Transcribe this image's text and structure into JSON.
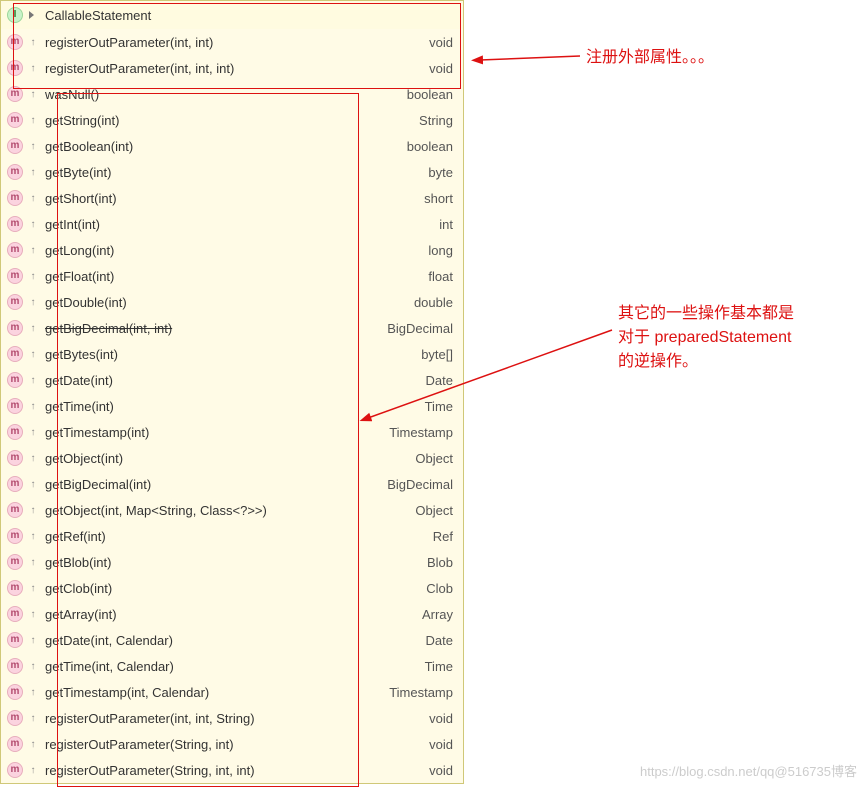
{
  "header": {
    "name": "CallableStatement"
  },
  "annotations": {
    "top": "注册外部属性。。。",
    "mid1": "其它的一些操作基本都是",
    "mid2": "对于   preparedStatement",
    "mid3": "的逆操作。"
  },
  "watermark": "https://blog.csdn.net/qq@516735博客",
  "methods": [
    {
      "name": "registerOutParameter(int, int)",
      "ret": "void",
      "mod": "↑"
    },
    {
      "name": "registerOutParameter(int, int, int)",
      "ret": "void",
      "mod": "↑"
    },
    {
      "name": "wasNull()",
      "ret": "boolean",
      "mod": "↑"
    },
    {
      "name": "getString(int)",
      "ret": "String",
      "mod": "↑"
    },
    {
      "name": "getBoolean(int)",
      "ret": "boolean",
      "mod": "↑"
    },
    {
      "name": "getByte(int)",
      "ret": "byte",
      "mod": "↑"
    },
    {
      "name": "getShort(int)",
      "ret": "short",
      "mod": "↑"
    },
    {
      "name": "getInt(int)",
      "ret": "int",
      "mod": "↑"
    },
    {
      "name": "getLong(int)",
      "ret": "long",
      "mod": "↑"
    },
    {
      "name": "getFloat(int)",
      "ret": "float",
      "mod": "↑"
    },
    {
      "name": "getDouble(int)",
      "ret": "double",
      "mod": "↑"
    },
    {
      "name": "getBigDecimal(int, int)",
      "ret": "BigDecimal",
      "mod": "↑",
      "deprecated": true
    },
    {
      "name": "getBytes(int)",
      "ret": "byte[]",
      "mod": "↑"
    },
    {
      "name": "getDate(int)",
      "ret": "Date",
      "mod": "↑"
    },
    {
      "name": "getTime(int)",
      "ret": "Time",
      "mod": "↑"
    },
    {
      "name": "getTimestamp(int)",
      "ret": "Timestamp",
      "mod": "↑"
    },
    {
      "name": "getObject(int)",
      "ret": "Object",
      "mod": "↑"
    },
    {
      "name": "getBigDecimal(int)",
      "ret": "BigDecimal",
      "mod": "↑"
    },
    {
      "name": "getObject(int, Map<String, Class<?>>)",
      "ret": "Object",
      "mod": "↑"
    },
    {
      "name": "getRef(int)",
      "ret": "Ref",
      "mod": "↑"
    },
    {
      "name": "getBlob(int)",
      "ret": "Blob",
      "mod": "↑"
    },
    {
      "name": "getClob(int)",
      "ret": "Clob",
      "mod": "↑"
    },
    {
      "name": "getArray(int)",
      "ret": "Array",
      "mod": "↑"
    },
    {
      "name": "getDate(int, Calendar)",
      "ret": "Date",
      "mod": "↑"
    },
    {
      "name": "getTime(int, Calendar)",
      "ret": "Time",
      "mod": "↑"
    },
    {
      "name": "getTimestamp(int, Calendar)",
      "ret": "Timestamp",
      "mod": "↑"
    },
    {
      "name": "registerOutParameter(int, int, String)",
      "ret": "void",
      "mod": "↑"
    },
    {
      "name": "registerOutParameter(String, int)",
      "ret": "void",
      "mod": "↑"
    },
    {
      "name": "registerOutParameter(String, int, int)",
      "ret": "void",
      "mod": "↑"
    }
  ]
}
